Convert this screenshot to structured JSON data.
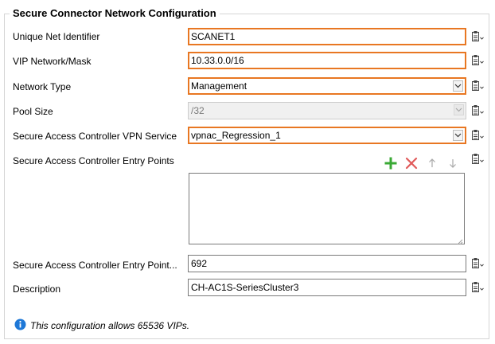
{
  "section": {
    "title": "Secure Connector Network Configuration"
  },
  "fields": {
    "unique_net_identifier": {
      "label": "Unique Net Identifier",
      "value": "SCANET1"
    },
    "vip_network_mask": {
      "label": "VIP Network/Mask",
      "value": "10.33.0.0/16"
    },
    "network_type": {
      "label": "Network Type",
      "value": "Management"
    },
    "pool_size": {
      "label": "Pool Size",
      "value": "/32"
    },
    "vpn_service": {
      "label": "Secure Access Controller VPN Service",
      "value": "vpnac_Regression_1"
    },
    "entry_points": {
      "label": "Secure Access Controller Entry Points",
      "items": []
    },
    "entry_point_port": {
      "label": "Secure Access Controller Entry Point...",
      "value": "692"
    },
    "description": {
      "label": "Description",
      "value": "CH-AC1S-SeriesCluster3"
    }
  },
  "info": {
    "text": "This configuration allows 65536 VIPs."
  },
  "colors": {
    "focus_border": "#e87722",
    "add_icon": "#3aa935",
    "remove_icon": "#e05a5a",
    "info_icon": "#1e78d7"
  },
  "icons": {
    "row_menu": "properties-menu-icon",
    "add": "plus-icon",
    "remove": "x-icon",
    "up": "arrow-up-icon",
    "down": "arrow-down-icon",
    "info": "info-icon"
  }
}
